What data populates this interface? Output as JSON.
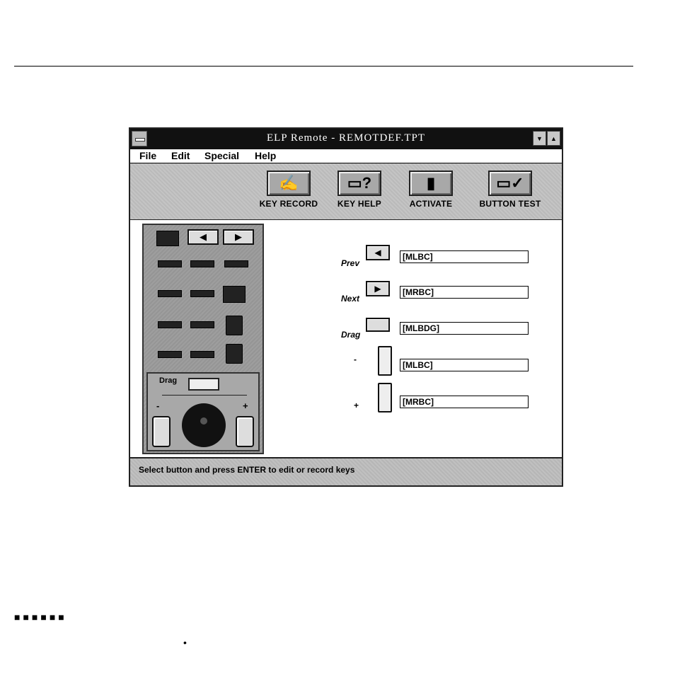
{
  "window": {
    "title": "ELP Remote - REMOTDEF.TPT",
    "min_glyph": "▼",
    "max_glyph": "▲"
  },
  "menu": {
    "items": [
      {
        "label": "File"
      },
      {
        "label": "Edit"
      },
      {
        "label": "Special"
      },
      {
        "label": "Help"
      }
    ]
  },
  "toolbar": {
    "buttons": [
      {
        "label": "KEY RECORD",
        "icon": "hand-key-icon"
      },
      {
        "label": "KEY HELP",
        "icon": "key-question-icon"
      },
      {
        "label": "ACTIVATE",
        "icon": "activate-icon"
      },
      {
        "label": "BUTTON TEST",
        "icon": "checkmark-icon"
      }
    ]
  },
  "remote": {
    "drag_label": "Drag",
    "minus": "-",
    "plus": "+",
    "left_arrow": "◀",
    "right_arrow": "▶"
  },
  "config": {
    "rows": [
      {
        "label": "Prev",
        "glyph": "◀",
        "value": "[MLBC]"
      },
      {
        "label": "Next",
        "glyph": "▶",
        "value": "[MRBC]"
      },
      {
        "label": "Drag",
        "glyph": "",
        "value": "[MLBDG]"
      },
      {
        "label": "-",
        "glyph": "",
        "value": "[MLBC]"
      },
      {
        "label": "+",
        "glyph": "",
        "value": "[MRBC]"
      }
    ]
  },
  "status": {
    "text": "Select button and press ENTER to edit or record keys"
  },
  "footer": {
    "dots": "■■■■■■",
    "dot": "•"
  }
}
